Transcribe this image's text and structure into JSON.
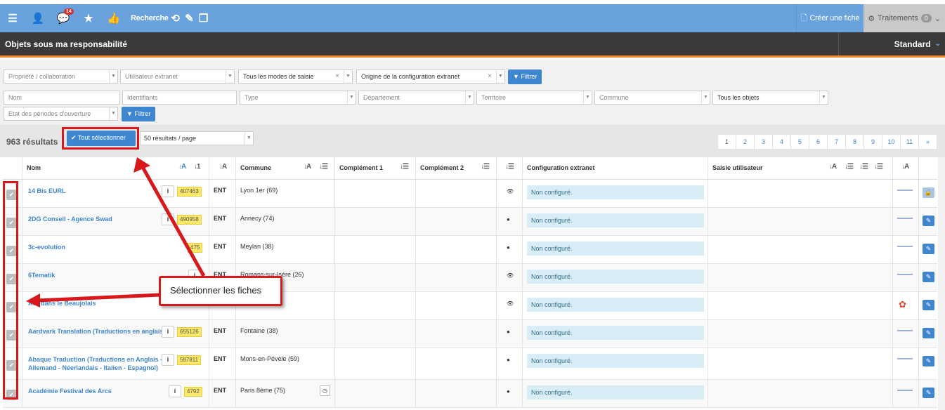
{
  "topbar": {
    "badge": "14",
    "search_label": "Recherche",
    "create_label": "Créer une fiche",
    "traitements_label": "Traitements",
    "traitements_count": "0"
  },
  "titlebar": {
    "title": "Objets sous ma responsabilité",
    "view": "Standard"
  },
  "filters": {
    "propriete": "Propriété / collaboration",
    "utilisateur": "Utilisateur extranet",
    "modes": "Tous les modes de saisie",
    "origine": "Origine de la configuration extranet",
    "filtrer": "Filtrer",
    "nom": "Nom",
    "identifiants": "Identifiants",
    "type": "Type",
    "departement": "Département",
    "territoire": "Territoire",
    "commune": "Commune",
    "objets": "Tous les objets",
    "periodes": "Etat des périodes d'ouverture",
    "filtrer2": "Filtrer"
  },
  "results": {
    "count": "963 résultats",
    "select_all": "Tout sélectionner",
    "per_page": "50 résultats / page",
    "pages": [
      "1",
      "2",
      "3",
      "4",
      "5",
      "6",
      "7",
      "8",
      "9",
      "10",
      "11",
      "»"
    ]
  },
  "columns": {
    "nom": "Nom",
    "commune": "Commune",
    "complement1": "Complément 1",
    "complement2": "Complément 2",
    "config": "Configuration extranet",
    "saisie": "Saisie utilisateur"
  },
  "rows": [
    {
      "name": "14 Bis EURL",
      "id": "407463",
      "type": "ENT",
      "commune": "Lyon 1er (69)",
      "config": "Non configuré."
    },
    {
      "name": "2DG Conseil - Agence Swad",
      "id": "490958",
      "type": "ENT",
      "commune": "Annecy (74)",
      "config": "Non configuré."
    },
    {
      "name": "3c-evolution",
      "id": "475",
      "type": "ENT",
      "commune": "Meylan (38)",
      "config": "Non configuré."
    },
    {
      "name": "6Tematik",
      "id": "",
      "type": "ENT",
      "commune": "Romans-sur-Isère (26)",
      "config": "Non configuré."
    },
    {
      "name": "A… dans le Beaujolais",
      "id": "",
      "type": "",
      "commune": "",
      "config": "Non configuré."
    },
    {
      "name": "Aardvark Translation (Traductions en anglais)",
      "id": "655126",
      "type": "ENT",
      "commune": "Fontaine (38)",
      "config": "Non configuré."
    },
    {
      "name": "Abaque Traduction (Traductions en Anglais - Allemand - Néerlandais - Italien - Espagnol)",
      "id": "587811",
      "type": "ENT",
      "commune": "Mons-en-Pévèle (59)",
      "config": "Non configuré."
    },
    {
      "name": "Académie Festival des Arcs",
      "id": "4792",
      "type": "ENT",
      "commune": "Paris 8ème (75)",
      "config": "Non configuré."
    }
  ],
  "annotation": "Sélectionner les fiches",
  "colors": {
    "accent": "#3f86d1",
    "topbar": "#6aa2de",
    "highlight": "#d7191c",
    "orange": "#f08a1e"
  }
}
